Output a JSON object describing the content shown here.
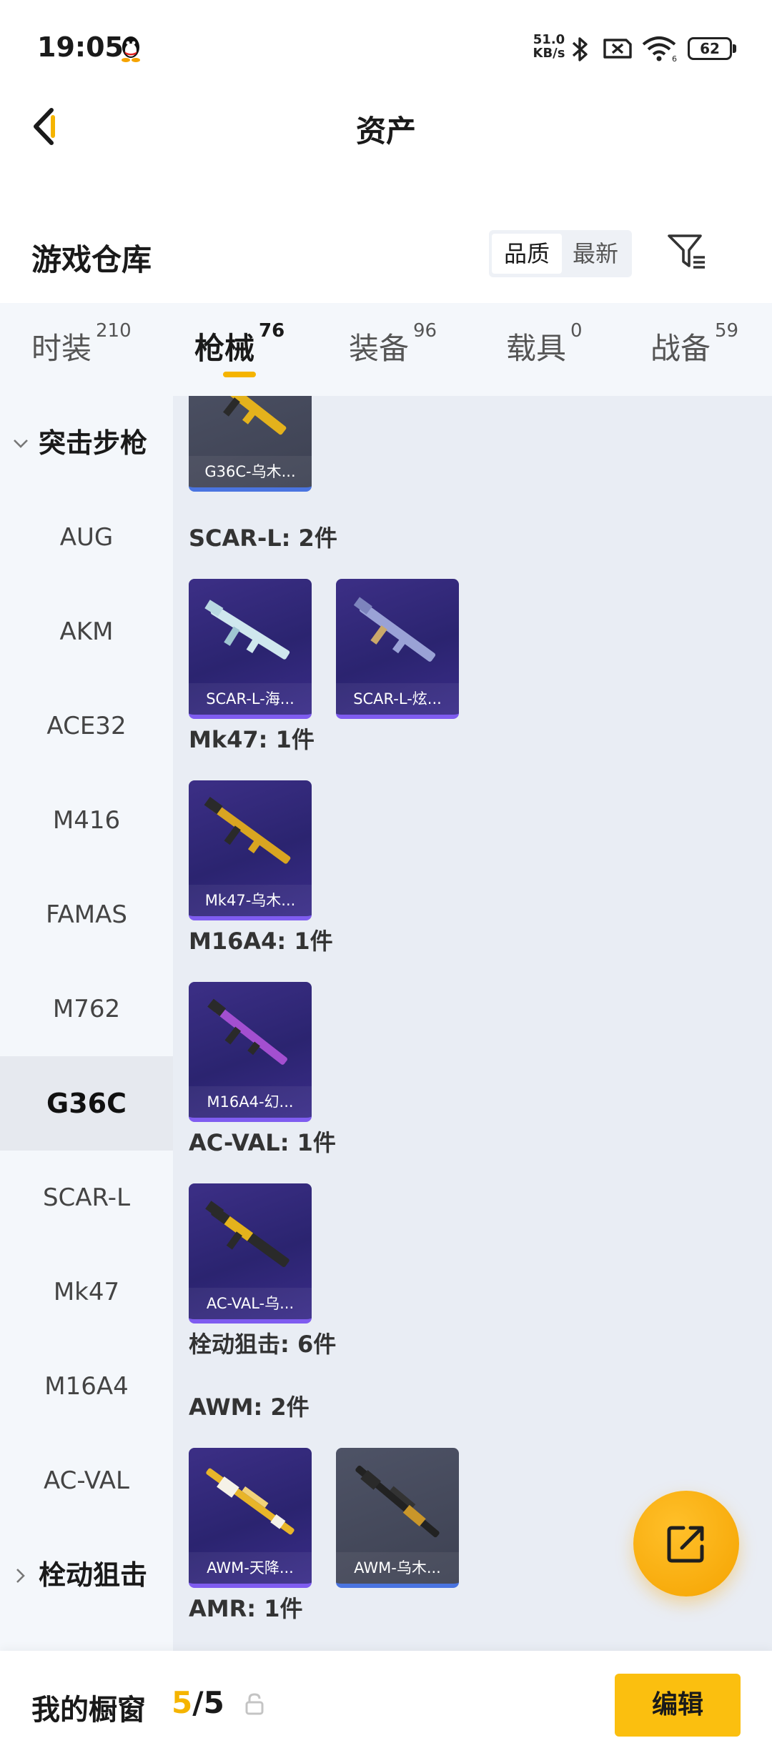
{
  "status_bar": {
    "time": "19:05",
    "net_speed_value": "51.0",
    "net_speed_unit": "KB/s",
    "battery": "62",
    "icons": [
      "qq-icon",
      "bluetooth-icon",
      "sim-off-icon",
      "wifi-icon",
      "battery-icon"
    ]
  },
  "header": {
    "title": "资产",
    "back_icon": "back-icon"
  },
  "warehouse": {
    "title": "游戏仓库",
    "sort_options": [
      "品质",
      "最新"
    ],
    "sort_selected": "品质",
    "filter_icon": "filter-icon"
  },
  "tabs": [
    {
      "label": "时装",
      "count": "210"
    },
    {
      "label": "枪械",
      "count": "76",
      "active": true
    },
    {
      "label": "装备",
      "count": "96"
    },
    {
      "label": "载具",
      "count": "0"
    },
    {
      "label": "战备",
      "count": "59"
    }
  ],
  "side_list": {
    "group_assault": "突击步枪",
    "items": [
      "AUG",
      "AKM",
      "ACE32",
      "M416",
      "FAMAS",
      "M762",
      "G36C",
      "SCAR-L",
      "Mk47",
      "M16A4",
      "AC-VAL"
    ],
    "active_item": "G36C",
    "group_sniper": "栓动狙击"
  },
  "content": {
    "groups": [
      {
        "label": "",
        "items": [
          {
            "name": "G36C-乌木...",
            "rarity": "gray"
          }
        ]
      },
      {
        "label": "SCAR-L: 2件",
        "items": [
          {
            "name": "SCAR-L-海...",
            "rarity": "purple"
          },
          {
            "name": "SCAR-L-炫...",
            "rarity": "purple"
          }
        ]
      },
      {
        "label": "Mk47: 1件",
        "items": [
          {
            "name": "Mk47-乌木...",
            "rarity": "purple"
          }
        ]
      },
      {
        "label": "M16A4: 1件",
        "items": [
          {
            "name": "M16A4-幻...",
            "rarity": "purple"
          }
        ]
      },
      {
        "label": "AC-VAL: 1件",
        "items": [
          {
            "name": "AC-VAL-乌...",
            "rarity": "purple"
          }
        ]
      }
    ],
    "sniper_label": "栓动狙击: 6件",
    "awm_label": "AWM: 2件",
    "awm_items": [
      {
        "name": "AWM-天降...",
        "rarity": "purple"
      },
      {
        "name": "AWM-乌木...",
        "rarity": "gray"
      }
    ],
    "amr_label": "AMR: 1件"
  },
  "fab": {
    "icon": "share-external-icon"
  },
  "bottom_bar": {
    "label": "我的橱窗",
    "current": "5",
    "separator": "/",
    "total": "5",
    "lock_icon": "lock-icon",
    "edit_label": "编辑"
  },
  "colors": {
    "accent": "#f5b400",
    "purple_card": "#2b2470",
    "gray_card": "#3d4152",
    "panel_bg": "#e9edf4"
  }
}
